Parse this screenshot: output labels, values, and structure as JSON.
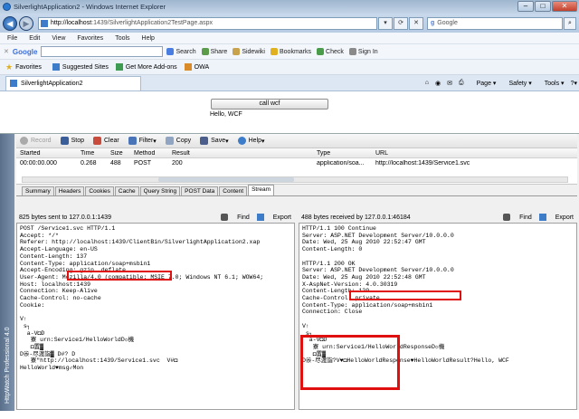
{
  "window": {
    "title": "SilverlightApplication2 - Windows Internet Explorer"
  },
  "address": {
    "host": "http://localhost",
    "path": ":1439/SilverlightApplication2TestPage.aspx"
  },
  "search": {
    "engine": "Google"
  },
  "menu": [
    "File",
    "Edit",
    "View",
    "Favorites",
    "Tools",
    "Help"
  ],
  "gtoolbar": {
    "logo": "Google",
    "items": [
      "Search",
      "Share",
      "Sidewiki",
      "Bookmarks",
      "Check",
      "Sign In"
    ]
  },
  "favorites": {
    "label": "Favorites",
    "items": [
      "Suggested Sites",
      "Get More Add-ons",
      "OWA"
    ]
  },
  "tab": {
    "title": "SilverlightApplication2"
  },
  "commands": [
    "Page",
    "Safety",
    "Tools"
  ],
  "page": {
    "button": "call wcf",
    "message": "Hello, WCF"
  },
  "httpwatch": {
    "side_label": "HttpWatch Professional 4.0",
    "toolbar": [
      "Record",
      "Stop",
      "Clear",
      "Filter",
      "Copy",
      "Save",
      "Help"
    ],
    "columns": [
      "Started",
      "Time",
      "Size",
      "Method",
      "Result",
      "Type",
      "URL"
    ],
    "rows": [
      [
        "00:00:00.000",
        "0.268",
        "488",
        "POST",
        "200",
        "application/soa...",
        "http://localhost:1439/Service1.svc"
      ]
    ],
    "tabs": [
      "Summary",
      "Headers",
      "Cookies",
      "Cache",
      "Query String",
      "POST Data",
      "Content",
      "Stream"
    ],
    "active_tab": "Stream",
    "request": {
      "header": "825 bytes sent to 127.0.0.1:1439",
      "find": "Find",
      "export": "Export",
      "body": "POST /Service1.svc HTTP/1.1\nAccept: */*\nReferer: http://localhost:1439/ClientBin/SilverlightApplication2.xap\nAccept-Language: en-US\nContent-Length: 137\nContent-Type: application/soap+msbin1\nAccept-Encoding: gzip, deflate\nUser-Agent: Mozilla/4.0 (compatible; MSIE 7.0; Windows NT 6.1; WOW64;\nHost: localhost:1439\nConnection: Keep-Alive\nCache-Control: no-cache\nCookie:\n\nV↑\n s┐\n  a-V◘D\n   寮 urn:Service1/HelloWorldD☼機\n   ◘置▓\nD尜-尽渡詣▓ D#? D\n   寮\"http://localhost:1439/Service1.svc  V#◘\nHelloWorld♥msg♂Mon"
    },
    "response": {
      "header": "488 bytes received by 127.0.0.1:46184",
      "find": "Find",
      "export": "Export",
      "body": "HTTP/1.1 100 Continue\nServer: ASP.NET Development Server/10.0.0.0\nDate: Wed, 25 Aug 2010 22:52:47 GMT\nContent-Length: 0\n\nHTTP/1.1 200 OK\nServer: ASP.NET Development Server/10.0.0.0\nDate: Wed, 25 Aug 2010 22:52:48 GMT\nX-AspNet-Version: 4.0.30319\nContent-Length: 129\nCache-Control: private\nContent-Type: application/soap+msbin1\nConnection: Close\n\nV↑\n s┐\n  a-V◘D\n   寮 urn:Service1/HelloWorldResponseD☼機\n   ◘置▓\nD尜-尽渡詣?V♥◘HelloWorldResponse♥HelloWorldResult?Hello, WCF"
    }
  },
  "colors": {
    "highlight": "#e01010",
    "ie_blue": "#2a7ad4"
  }
}
